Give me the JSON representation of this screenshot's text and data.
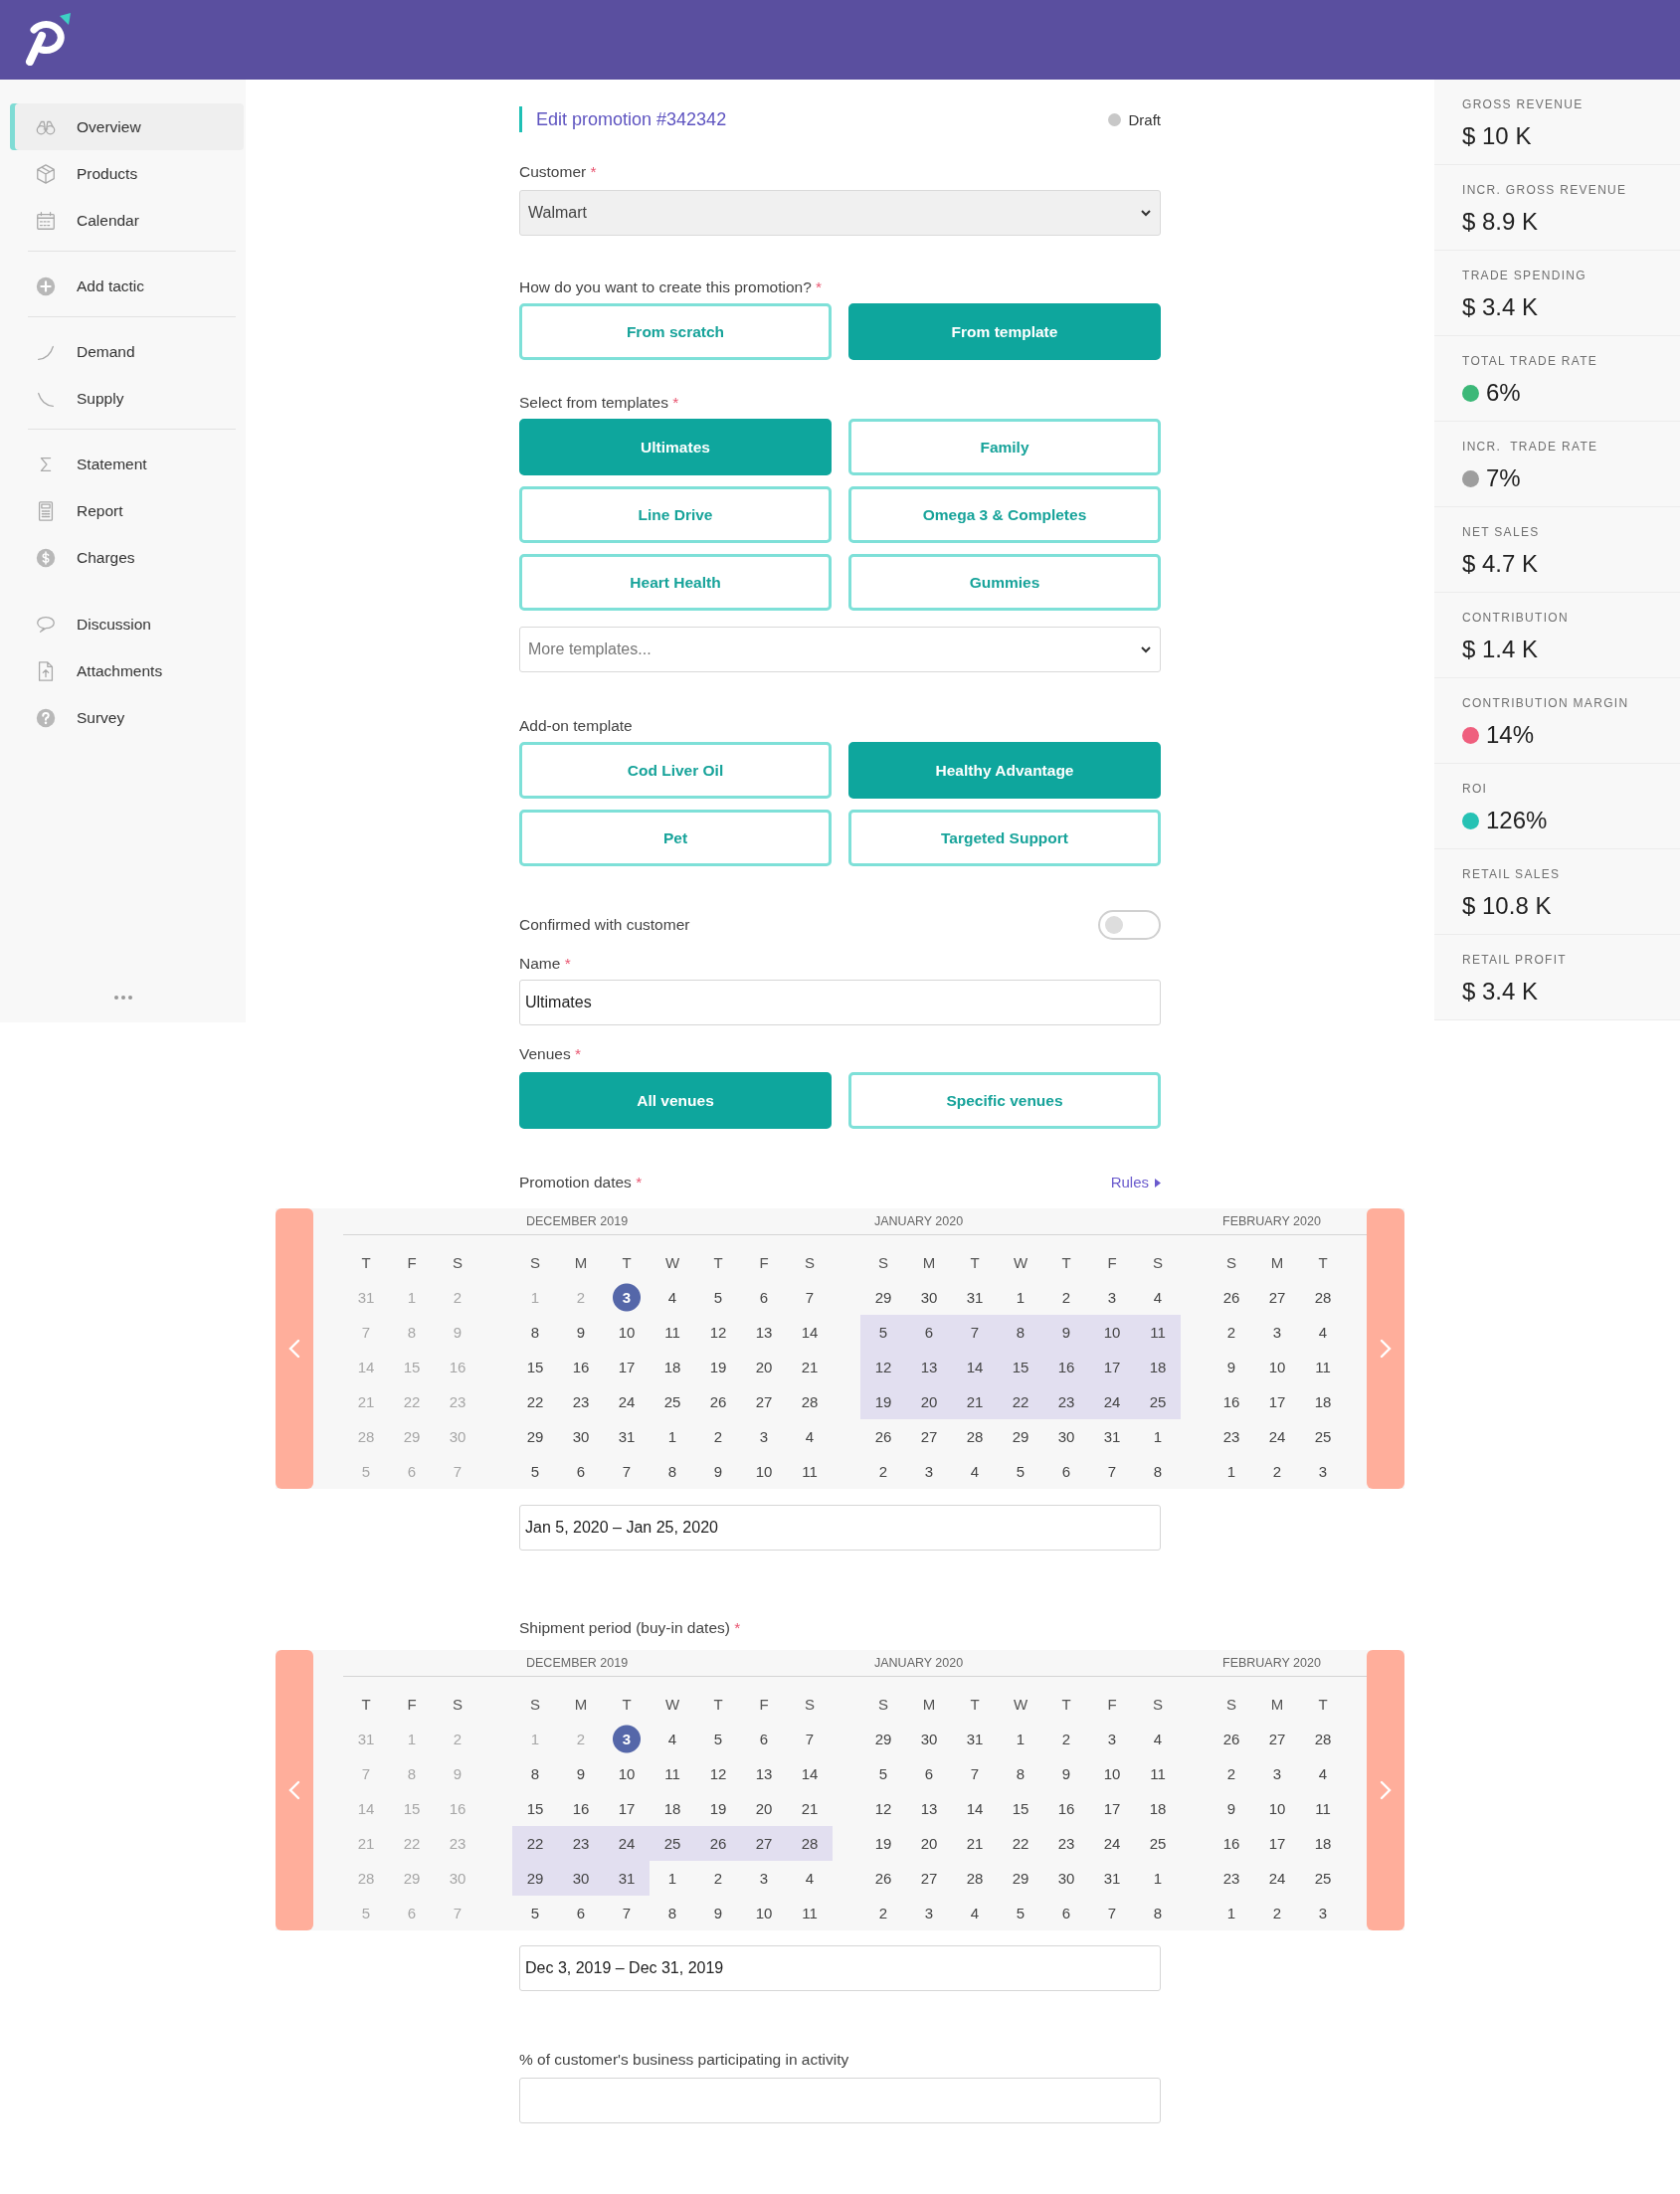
{
  "sidebar": {
    "sections": [
      {
        "divider": true,
        "items": [
          {
            "label": "Overview",
            "selected": true
          },
          {
            "label": "Products",
            "selected": false
          },
          {
            "label": "Calendar",
            "selected": false
          }
        ]
      },
      {
        "divider": true,
        "items": [
          {
            "label": "Add tactic",
            "selected": false
          }
        ]
      },
      {
        "divider": true,
        "items": [
          {
            "label": "Demand",
            "selected": false
          },
          {
            "label": "Supply",
            "selected": false
          }
        ]
      },
      {
        "divider": false,
        "items": [
          {
            "label": "Statement",
            "selected": false
          },
          {
            "label": "Report",
            "selected": false
          },
          {
            "label": "Charges",
            "selected": false
          }
        ]
      },
      {
        "divider": false,
        "items": [
          {
            "label": "Discussion",
            "selected": false
          },
          {
            "label": "Attachments",
            "selected": false
          },
          {
            "label": "Survey",
            "selected": false
          }
        ]
      }
    ]
  },
  "form": {
    "title": "Edit promotion #342342",
    "status": "Draft",
    "customer": {
      "label": "Customer",
      "mark": "*",
      "value": "Walmart"
    },
    "creation": {
      "label": "How do you want to create this promotion?",
      "mark": "*",
      "options": [
        {
          "label": "From scratch",
          "selected": false
        },
        {
          "label": "From template",
          "selected": true
        }
      ]
    },
    "templates": {
      "label": "Select from templates",
      "mark": "*",
      "options": [
        {
          "label": "Ultimates",
          "selected": true
        },
        {
          "label": "Family",
          "selected": false
        },
        {
          "label": "Line Drive",
          "selected": false
        },
        {
          "label": "Omega 3 & Completes",
          "selected": false
        },
        {
          "label": "Heart Health",
          "selected": false
        },
        {
          "label": "Gummies",
          "selected": false
        }
      ],
      "more": {
        "placeholder": "More templates..."
      }
    },
    "addon": {
      "label": "Add-on template",
      "options": [
        {
          "label": "Cod Liver Oil",
          "selected": false
        },
        {
          "label": "Healthy Advantage",
          "selected": true
        },
        {
          "label": "Pet",
          "selected": false
        },
        {
          "label": "Targeted Support",
          "selected": false
        }
      ]
    },
    "confirmed": {
      "label": "Confirmed with customer",
      "on": false
    },
    "name": {
      "label": "Name",
      "mark": "*",
      "value": "Ultimates"
    },
    "venues": {
      "label": "Venues",
      "mark": "*",
      "options": [
        {
          "label": "All venues",
          "selected": true
        },
        {
          "label": "Specific venues",
          "selected": false
        }
      ]
    },
    "promotion_dates": {
      "label": "Promotion dates",
      "mark": "*",
      "link": "Rules",
      "value": "Jan 5, 2020 – Jan 25, 2020",
      "calendar": {
        "months": [
          {
            "weekdays": [
              "T",
              "F",
              "S"
            ],
            "weeks": [
              [
                {
                  "day": "31",
                  "kind": "muted"
                },
                {
                  "day": "1",
                  "kind": "muted"
                },
                {
                  "day": "2",
                  "kind": "muted"
                }
              ],
              [
                {
                  "day": "7",
                  "kind": "muted"
                },
                {
                  "day": "8",
                  "kind": "muted"
                },
                {
                  "day": "9",
                  "kind": "muted"
                }
              ],
              [
                {
                  "day": "14",
                  "kind": "muted"
                },
                {
                  "day": "15",
                  "kind": "muted"
                },
                {
                  "day": "16",
                  "kind": "muted"
                }
              ],
              [
                {
                  "day": "21",
                  "kind": "muted"
                },
                {
                  "day": "22",
                  "kind": "muted"
                },
                {
                  "day": "23",
                  "kind": "muted"
                }
              ],
              [
                {
                  "day": "28",
                  "kind": "muted"
                },
                {
                  "day": "29",
                  "kind": "muted"
                },
                {
                  "day": "30",
                  "kind": "muted"
                }
              ],
              [
                {
                  "day": "5",
                  "kind": "muted"
                },
                {
                  "day": "6",
                  "kind": "muted"
                },
                {
                  "day": "7",
                  "kind": "muted"
                }
              ]
            ]
          },
          {
            "title": "DECEMBER 2019",
            "weekdays": [
              "S",
              "M",
              "T",
              "W",
              "T",
              "F",
              "S"
            ],
            "weeks": [
              [
                {
                  "day": "1",
                  "kind": "muted"
                },
                {
                  "day": "2",
                  "kind": "muted"
                },
                {
                  "day": "3",
                  "kind": "today"
                },
                {
                  "day": "4",
                  "kind": "normal"
                },
                {
                  "day": "5",
                  "kind": "normal"
                },
                {
                  "day": "6",
                  "kind": "normal"
                },
                {
                  "day": "7",
                  "kind": "normal"
                }
              ],
              [
                {
                  "day": "8",
                  "kind": "normal"
                },
                {
                  "day": "9",
                  "kind": "normal"
                },
                {
                  "day": "10",
                  "kind": "normal"
                },
                {
                  "day": "11",
                  "kind": "normal"
                },
                {
                  "day": "12",
                  "kind": "normal"
                },
                {
                  "day": "13",
                  "kind": "normal"
                },
                {
                  "day": "14",
                  "kind": "normal"
                }
              ],
              [
                {
                  "day": "15",
                  "kind": "normal"
                },
                {
                  "day": "16",
                  "kind": "normal"
                },
                {
                  "day": "17",
                  "kind": "normal"
                },
                {
                  "day": "18",
                  "kind": "normal"
                },
                {
                  "day": "19",
                  "kind": "normal"
                },
                {
                  "day": "20",
                  "kind": "normal"
                },
                {
                  "day": "21",
                  "kind": "normal"
                }
              ],
              [
                {
                  "day": "22",
                  "kind": "normal"
                },
                {
                  "day": "23",
                  "kind": "normal"
                },
                {
                  "day": "24",
                  "kind": "normal"
                },
                {
                  "day": "25",
                  "kind": "normal"
                },
                {
                  "day": "26",
                  "kind": "normal"
                },
                {
                  "day": "27",
                  "kind": "normal"
                },
                {
                  "day": "28",
                  "kind": "normal"
                }
              ],
              [
                {
                  "day": "29",
                  "kind": "normal"
                },
                {
                  "day": "30",
                  "kind": "normal"
                },
                {
                  "day": "31",
                  "kind": "normal"
                },
                {
                  "day": "1",
                  "kind": "normal"
                },
                {
                  "day": "2",
                  "kind": "normal"
                },
                {
                  "day": "3",
                  "kind": "normal"
                },
                {
                  "day": "4",
                  "kind": "normal"
                }
              ],
              [
                {
                  "day": "5",
                  "kind": "normal"
                },
                {
                  "day": "6",
                  "kind": "normal"
                },
                {
                  "day": "7",
                  "kind": "normal"
                },
                {
                  "day": "8",
                  "kind": "normal"
                },
                {
                  "day": "9",
                  "kind": "normal"
                },
                {
                  "day": "10",
                  "kind": "normal"
                },
                {
                  "day": "11",
                  "kind": "normal"
                }
              ]
            ]
          },
          {
            "title": "JANUARY 2020",
            "weekdays": [
              "S",
              "M",
              "T",
              "W",
              "T",
              "F",
              "S"
            ],
            "weeks": [
              [
                {
                  "day": "29",
                  "kind": "normal"
                },
                {
                  "day": "30",
                  "kind": "normal"
                },
                {
                  "day": "31",
                  "kind": "normal"
                },
                {
                  "day": "1",
                  "kind": "normal"
                },
                {
                  "day": "2",
                  "kind": "normal"
                },
                {
                  "day": "3",
                  "kind": "normal"
                },
                {
                  "day": "4",
                  "kind": "normal"
                }
              ],
              [
                {
                  "day": "5",
                  "kind": "range"
                },
                {
                  "day": "6",
                  "kind": "range"
                },
                {
                  "day": "7",
                  "kind": "range"
                },
                {
                  "day": "8",
                  "kind": "range"
                },
                {
                  "day": "9",
                  "kind": "range"
                },
                {
                  "day": "10",
                  "kind": "range"
                },
                {
                  "day": "11",
                  "kind": "range"
                }
              ],
              [
                {
                  "day": "12",
                  "kind": "range"
                },
                {
                  "day": "13",
                  "kind": "range"
                },
                {
                  "day": "14",
                  "kind": "range"
                },
                {
                  "day": "15",
                  "kind": "range"
                },
                {
                  "day": "16",
                  "kind": "range"
                },
                {
                  "day": "17",
                  "kind": "range"
                },
                {
                  "day": "18",
                  "kind": "range"
                }
              ],
              [
                {
                  "day": "19",
                  "kind": "range"
                },
                {
                  "day": "20",
                  "kind": "range"
                },
                {
                  "day": "21",
                  "kind": "range"
                },
                {
                  "day": "22",
                  "kind": "range"
                },
                {
                  "day": "23",
                  "kind": "range"
                },
                {
                  "day": "24",
                  "kind": "range"
                },
                {
                  "day": "25",
                  "kind": "range"
                }
              ],
              [
                {
                  "day": "26",
                  "kind": "normal"
                },
                {
                  "day": "27",
                  "kind": "normal"
                },
                {
                  "day": "28",
                  "kind": "normal"
                },
                {
                  "day": "29",
                  "kind": "normal"
                },
                {
                  "day": "30",
                  "kind": "normal"
                },
                {
                  "day": "31",
                  "kind": "normal"
                },
                {
                  "day": "1",
                  "kind": "normal"
                }
              ],
              [
                {
                  "day": "2",
                  "kind": "normal"
                },
                {
                  "day": "3",
                  "kind": "normal"
                },
                {
                  "day": "4",
                  "kind": "normal"
                },
                {
                  "day": "5",
                  "kind": "normal"
                },
                {
                  "day": "6",
                  "kind": "normal"
                },
                {
                  "day": "7",
                  "kind": "normal"
                },
                {
                  "day": "8",
                  "kind": "normal"
                }
              ]
            ]
          },
          {
            "title": "FEBRUARY 2020",
            "weekdays": [
              "S",
              "M",
              "T"
            ],
            "weeks": [
              [
                {
                  "day": "26",
                  "kind": "normal"
                },
                {
                  "day": "27",
                  "kind": "normal"
                },
                {
                  "day": "28",
                  "kind": "normal"
                }
              ],
              [
                {
                  "day": "2",
                  "kind": "normal"
                },
                {
                  "day": "3",
                  "kind": "normal"
                },
                {
                  "day": "4",
                  "kind": "normal"
                }
              ],
              [
                {
                  "day": "9",
                  "kind": "normal"
                },
                {
                  "day": "10",
                  "kind": "normal"
                },
                {
                  "day": "11",
                  "kind": "normal"
                }
              ],
              [
                {
                  "day": "16",
                  "kind": "normal"
                },
                {
                  "day": "17",
                  "kind": "normal"
                },
                {
                  "day": "18",
                  "kind": "normal"
                }
              ],
              [
                {
                  "day": "23",
                  "kind": "normal"
                },
                {
                  "day": "24",
                  "kind": "normal"
                },
                {
                  "day": "25",
                  "kind": "normal"
                }
              ],
              [
                {
                  "day": "1",
                  "kind": "normal"
                },
                {
                  "day": "2",
                  "kind": "normal"
                },
                {
                  "day": "3",
                  "kind": "normal"
                }
              ]
            ]
          }
        ]
      }
    },
    "shipment_period": {
      "label": "Shipment period (buy-in dates)",
      "mark": "*",
      "value": "Dec 3, 2019 – Dec 31, 2019",
      "calendar": {
        "months": [
          {
            "weekdays": [
              "T",
              "F",
              "S"
            ],
            "weeks": [
              [
                {
                  "day": "31",
                  "kind": "muted"
                },
                {
                  "day": "1",
                  "kind": "muted"
                },
                {
                  "day": "2",
                  "kind": "muted"
                }
              ],
              [
                {
                  "day": "7",
                  "kind": "muted"
                },
                {
                  "day": "8",
                  "kind": "muted"
                },
                {
                  "day": "9",
                  "kind": "muted"
                }
              ],
              [
                {
                  "day": "14",
                  "kind": "muted"
                },
                {
                  "day": "15",
                  "kind": "muted"
                },
                {
                  "day": "16",
                  "kind": "muted"
                }
              ],
              [
                {
                  "day": "21",
                  "kind": "muted"
                },
                {
                  "day": "22",
                  "kind": "muted"
                },
                {
                  "day": "23",
                  "kind": "muted"
                }
              ],
              [
                {
                  "day": "28",
                  "kind": "muted"
                },
                {
                  "day": "29",
                  "kind": "muted"
                },
                {
                  "day": "30",
                  "kind": "muted"
                }
              ],
              [
                {
                  "day": "5",
                  "kind": "muted"
                },
                {
                  "day": "6",
                  "kind": "muted"
                },
                {
                  "day": "7",
                  "kind": "muted"
                }
              ]
            ]
          },
          {
            "title": "DECEMBER 2019",
            "weekdays": [
              "S",
              "M",
              "T",
              "W",
              "T",
              "F",
              "S"
            ],
            "weeks": [
              [
                {
                  "day": "1",
                  "kind": "muted"
                },
                {
                  "day": "2",
                  "kind": "muted"
                },
                {
                  "day": "3",
                  "kind": "today"
                },
                {
                  "day": "4",
                  "kind": "normal"
                },
                {
                  "day": "5",
                  "kind": "normal"
                },
                {
                  "day": "6",
                  "kind": "normal"
                },
                {
                  "day": "7",
                  "kind": "normal"
                }
              ],
              [
                {
                  "day": "8",
                  "kind": "normal"
                },
                {
                  "day": "9",
                  "kind": "normal"
                },
                {
                  "day": "10",
                  "kind": "normal"
                },
                {
                  "day": "11",
                  "kind": "normal"
                },
                {
                  "day": "12",
                  "kind": "normal"
                },
                {
                  "day": "13",
                  "kind": "normal"
                },
                {
                  "day": "14",
                  "kind": "normal"
                }
              ],
              [
                {
                  "day": "15",
                  "kind": "normal"
                },
                {
                  "day": "16",
                  "kind": "normal"
                },
                {
                  "day": "17",
                  "kind": "normal"
                },
                {
                  "day": "18",
                  "kind": "normal"
                },
                {
                  "day": "19",
                  "kind": "normal"
                },
                {
                  "day": "20",
                  "kind": "normal"
                },
                {
                  "day": "21",
                  "kind": "normal"
                }
              ],
              [
                {
                  "day": "22",
                  "kind": "range"
                },
                {
                  "day": "23",
                  "kind": "range"
                },
                {
                  "day": "24",
                  "kind": "range"
                },
                {
                  "day": "25",
                  "kind": "range"
                },
                {
                  "day": "26",
                  "kind": "range"
                },
                {
                  "day": "27",
                  "kind": "range"
                },
                {
                  "day": "28",
                  "kind": "range"
                }
              ],
              [
                {
                  "day": "29",
                  "kind": "range"
                },
                {
                  "day": "30",
                  "kind": "range"
                },
                {
                  "day": "31",
                  "kind": "range"
                },
                {
                  "day": "1",
                  "kind": "normal"
                },
                {
                  "day": "2",
                  "kind": "normal"
                },
                {
                  "day": "3",
                  "kind": "normal"
                },
                {
                  "day": "4",
                  "kind": "normal"
                }
              ],
              [
                {
                  "day": "5",
                  "kind": "normal"
                },
                {
                  "day": "6",
                  "kind": "normal"
                },
                {
                  "day": "7",
                  "kind": "normal"
                },
                {
                  "day": "8",
                  "kind": "normal"
                },
                {
                  "day": "9",
                  "kind": "normal"
                },
                {
                  "day": "10",
                  "kind": "normal"
                },
                {
                  "day": "11",
                  "kind": "normal"
                }
              ]
            ]
          },
          {
            "title": "JANUARY 2020",
            "weekdays": [
              "S",
              "M",
              "T",
              "W",
              "T",
              "F",
              "S"
            ],
            "weeks": [
              [
                {
                  "day": "29",
                  "kind": "normal"
                },
                {
                  "day": "30",
                  "kind": "normal"
                },
                {
                  "day": "31",
                  "kind": "normal"
                },
                {
                  "day": "1",
                  "kind": "normal"
                },
                {
                  "day": "2",
                  "kind": "normal"
                },
                {
                  "day": "3",
                  "kind": "normal"
                },
                {
                  "day": "4",
                  "kind": "normal"
                }
              ],
              [
                {
                  "day": "5",
                  "kind": "normal"
                },
                {
                  "day": "6",
                  "kind": "normal"
                },
                {
                  "day": "7",
                  "kind": "normal"
                },
                {
                  "day": "8",
                  "kind": "normal"
                },
                {
                  "day": "9",
                  "kind": "normal"
                },
                {
                  "day": "10",
                  "kind": "normal"
                },
                {
                  "day": "11",
                  "kind": "normal"
                }
              ],
              [
                {
                  "day": "12",
                  "kind": "normal"
                },
                {
                  "day": "13",
                  "kind": "normal"
                },
                {
                  "day": "14",
                  "kind": "normal"
                },
                {
                  "day": "15",
                  "kind": "normal"
                },
                {
                  "day": "16",
                  "kind": "normal"
                },
                {
                  "day": "17",
                  "kind": "normal"
                },
                {
                  "day": "18",
                  "kind": "normal"
                }
              ],
              [
                {
                  "day": "19",
                  "kind": "normal"
                },
                {
                  "day": "20",
                  "kind": "normal"
                },
                {
                  "day": "21",
                  "kind": "normal"
                },
                {
                  "day": "22",
                  "kind": "normal"
                },
                {
                  "day": "23",
                  "kind": "normal"
                },
                {
                  "day": "24",
                  "kind": "normal"
                },
                {
                  "day": "25",
                  "kind": "normal"
                }
              ],
              [
                {
                  "day": "26",
                  "kind": "normal"
                },
                {
                  "day": "27",
                  "kind": "normal"
                },
                {
                  "day": "28",
                  "kind": "normal"
                },
                {
                  "day": "29",
                  "kind": "normal"
                },
                {
                  "day": "30",
                  "kind": "normal"
                },
                {
                  "day": "31",
                  "kind": "normal"
                },
                {
                  "day": "1",
                  "kind": "normal"
                }
              ],
              [
                {
                  "day": "2",
                  "kind": "normal"
                },
                {
                  "day": "3",
                  "kind": "normal"
                },
                {
                  "day": "4",
                  "kind": "normal"
                },
                {
                  "day": "5",
                  "kind": "normal"
                },
                {
                  "day": "6",
                  "kind": "normal"
                },
                {
                  "day": "7",
                  "kind": "normal"
                },
                {
                  "day": "8",
                  "kind": "normal"
                }
              ]
            ]
          },
          {
            "title": "FEBRUARY 2020",
            "weekdays": [
              "S",
              "M",
              "T"
            ],
            "weeks": [
              [
                {
                  "day": "26",
                  "kind": "normal"
                },
                {
                  "day": "27",
                  "kind": "normal"
                },
                {
                  "day": "28",
                  "kind": "normal"
                }
              ],
              [
                {
                  "day": "2",
                  "kind": "normal"
                },
                {
                  "day": "3",
                  "kind": "normal"
                },
                {
                  "day": "4",
                  "kind": "normal"
                }
              ],
              [
                {
                  "day": "9",
                  "kind": "normal"
                },
                {
                  "day": "10",
                  "kind": "normal"
                },
                {
                  "day": "11",
                  "kind": "normal"
                }
              ],
              [
                {
                  "day": "16",
                  "kind": "normal"
                },
                {
                  "day": "17",
                  "kind": "normal"
                },
                {
                  "day": "18",
                  "kind": "normal"
                }
              ],
              [
                {
                  "day": "23",
                  "kind": "normal"
                },
                {
                  "day": "24",
                  "kind": "normal"
                },
                {
                  "day": "25",
                  "kind": "normal"
                }
              ],
              [
                {
                  "day": "1",
                  "kind": "normal"
                },
                {
                  "day": "2",
                  "kind": "normal"
                },
                {
                  "day": "3",
                  "kind": "normal"
                }
              ]
            ]
          }
        ]
      }
    },
    "participation": {
      "label": "% of customer's business participating in activity"
    }
  },
  "metrics": [
    {
      "label": "GROSS REVENUE",
      "value": "$ 10 K"
    },
    {
      "label": "INCR. GROSS REVENUE",
      "value": "$ 8.9 K"
    },
    {
      "label": "TRADE SPENDING",
      "value": "$ 3.4 K"
    },
    {
      "label": "TOTAL TRADE RATE",
      "value": "6%",
      "color": "#3cb878"
    },
    {
      "label": "INCR.  TRADE RATE",
      "value": "7%",
      "color": "#9e9e9e"
    },
    {
      "label": "NET SALES",
      "value": "$ 4.7 K"
    },
    {
      "label": "CONTRIBUTION",
      "value": "$ 1.4 K"
    },
    {
      "label": "CONTRIBUTION MARGIN",
      "value": "14%",
      "color": "#ef5f7e"
    },
    {
      "label": "ROI",
      "value": "126%",
      "color": "#26c2b4"
    },
    {
      "label": "RETAIL SALES",
      "value": "$ 10.8 K"
    },
    {
      "label": "RETAIL PROFIT",
      "value": "$ 3.4 K"
    }
  ]
}
